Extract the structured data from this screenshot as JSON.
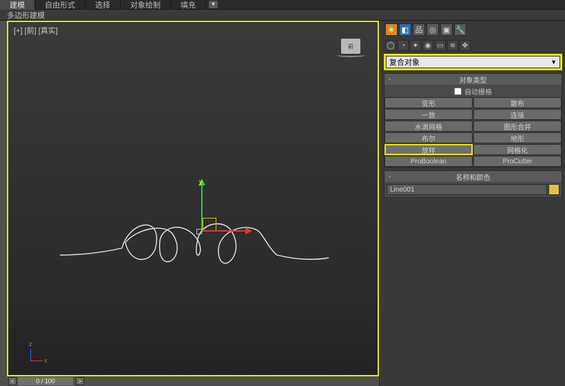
{
  "top_tabs": {
    "t0": "建模",
    "t1": "自由形式",
    "t2": "选择",
    "t3": "对象绘制",
    "t4": "填充"
  },
  "sub_tabs": {
    "s0": "多边形建模"
  },
  "viewport": {
    "label": "[+] [前] [真实]",
    "viewcube_face": "前",
    "axis_y": "y",
    "axis_z": "z",
    "axis_x": "x"
  },
  "timeline": {
    "prev": "<",
    "frame": "0 / 100",
    "next": ">"
  },
  "combo": {
    "value": "复合对象",
    "arrow": "▼"
  },
  "rollout1": {
    "title": "对象类型",
    "checkbox": "自动栅格",
    "btns": {
      "b0": "变形",
      "b1": "散布",
      "b2": "一致",
      "b3": "连接",
      "b4": "水滴网格",
      "b5": "图形合并",
      "b6": "布尔",
      "b7": "地形",
      "b8": "放样",
      "b9": "网格化",
      "b10": "ProBoolean",
      "b11": "ProCutter"
    }
  },
  "rollout2": {
    "title": "名称和颜色",
    "object_name": "Line001"
  }
}
